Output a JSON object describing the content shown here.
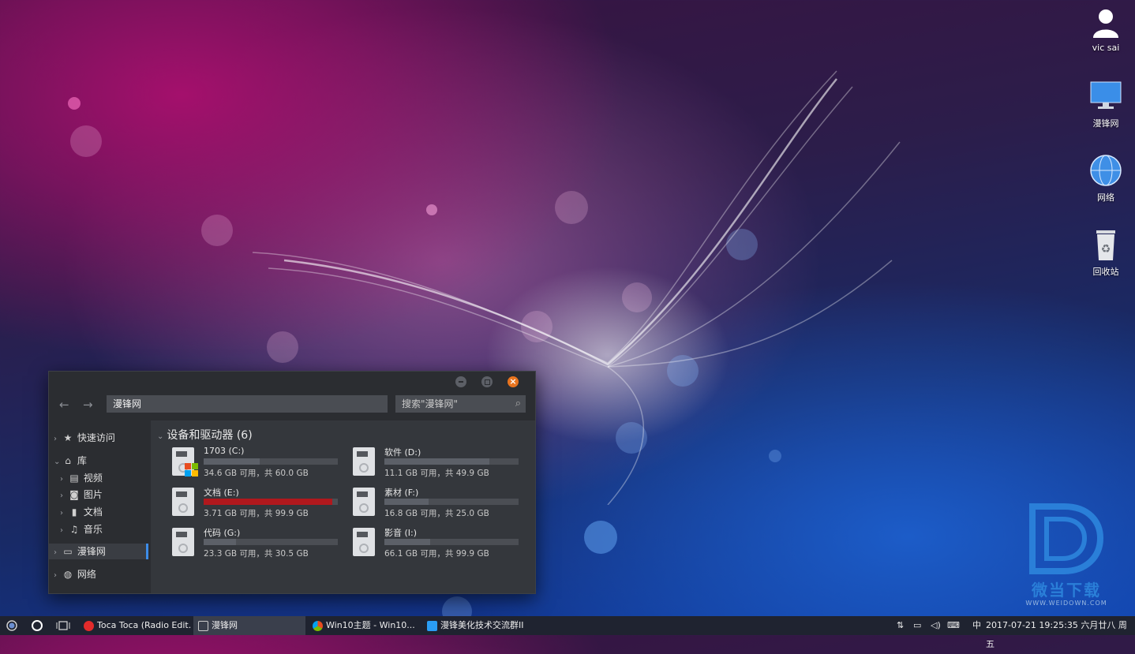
{
  "desktop": {
    "icons": [
      {
        "label": "vic sai"
      },
      {
        "label": "漫锋网"
      },
      {
        "label": "网络"
      },
      {
        "label": "回收站"
      }
    ],
    "logo": {
      "title": "微当下载",
      "url": "WWW.WEIDOWN.COM"
    }
  },
  "explorer": {
    "address": "漫锋网",
    "search_placeholder": "搜索\"漫锋网\"",
    "sidebar": [
      {
        "label": "快速访问"
      },
      {
        "label": "库"
      },
      {
        "label": "视频"
      },
      {
        "label": "图片"
      },
      {
        "label": "文档"
      },
      {
        "label": "音乐"
      },
      {
        "label": "漫锋网"
      },
      {
        "label": "网络"
      }
    ],
    "section_title": "设备和驱动器 (6)",
    "drives": [
      {
        "name": "1703 (C:)",
        "info": "34.6 GB 可用，共 60.0 GB",
        "used_fraction": 0.42
      },
      {
        "name": "软件 (D:)",
        "info": "11.1 GB 可用，共 49.9 GB",
        "used_fraction": 0.78
      },
      {
        "name": "文档 (E:)",
        "info": "3.71 GB 可用，共 99.9 GB",
        "used_fraction": 0.96
      },
      {
        "name": "素材 (F:)",
        "info": "16.8 GB 可用，共 25.0 GB",
        "used_fraction": 0.33
      },
      {
        "name": "代码 (G:)",
        "info": "23.3 GB 可用，共 30.5 GB",
        "used_fraction": 0.24
      },
      {
        "name": "影音 (I:)",
        "info": "66.1 GB 可用，共 99.9 GB",
        "used_fraction": 0.34
      }
    ],
    "colors": {
      "accent": "#3d8ce8",
      "critical_bar": "#b0181d",
      "close_button": "#e8741f"
    }
  },
  "taskbar": {
    "tasks": [
      {
        "label": "Toca Toca (Radio Edit..."
      },
      {
        "label": "漫锋网"
      },
      {
        "label": "Win10主题 - Win10..."
      },
      {
        "label": "漫锋美化技术交流群II"
      }
    ],
    "ime": "中",
    "datetime": "2017-07-21  19:25:35 六月廿八 周五"
  }
}
